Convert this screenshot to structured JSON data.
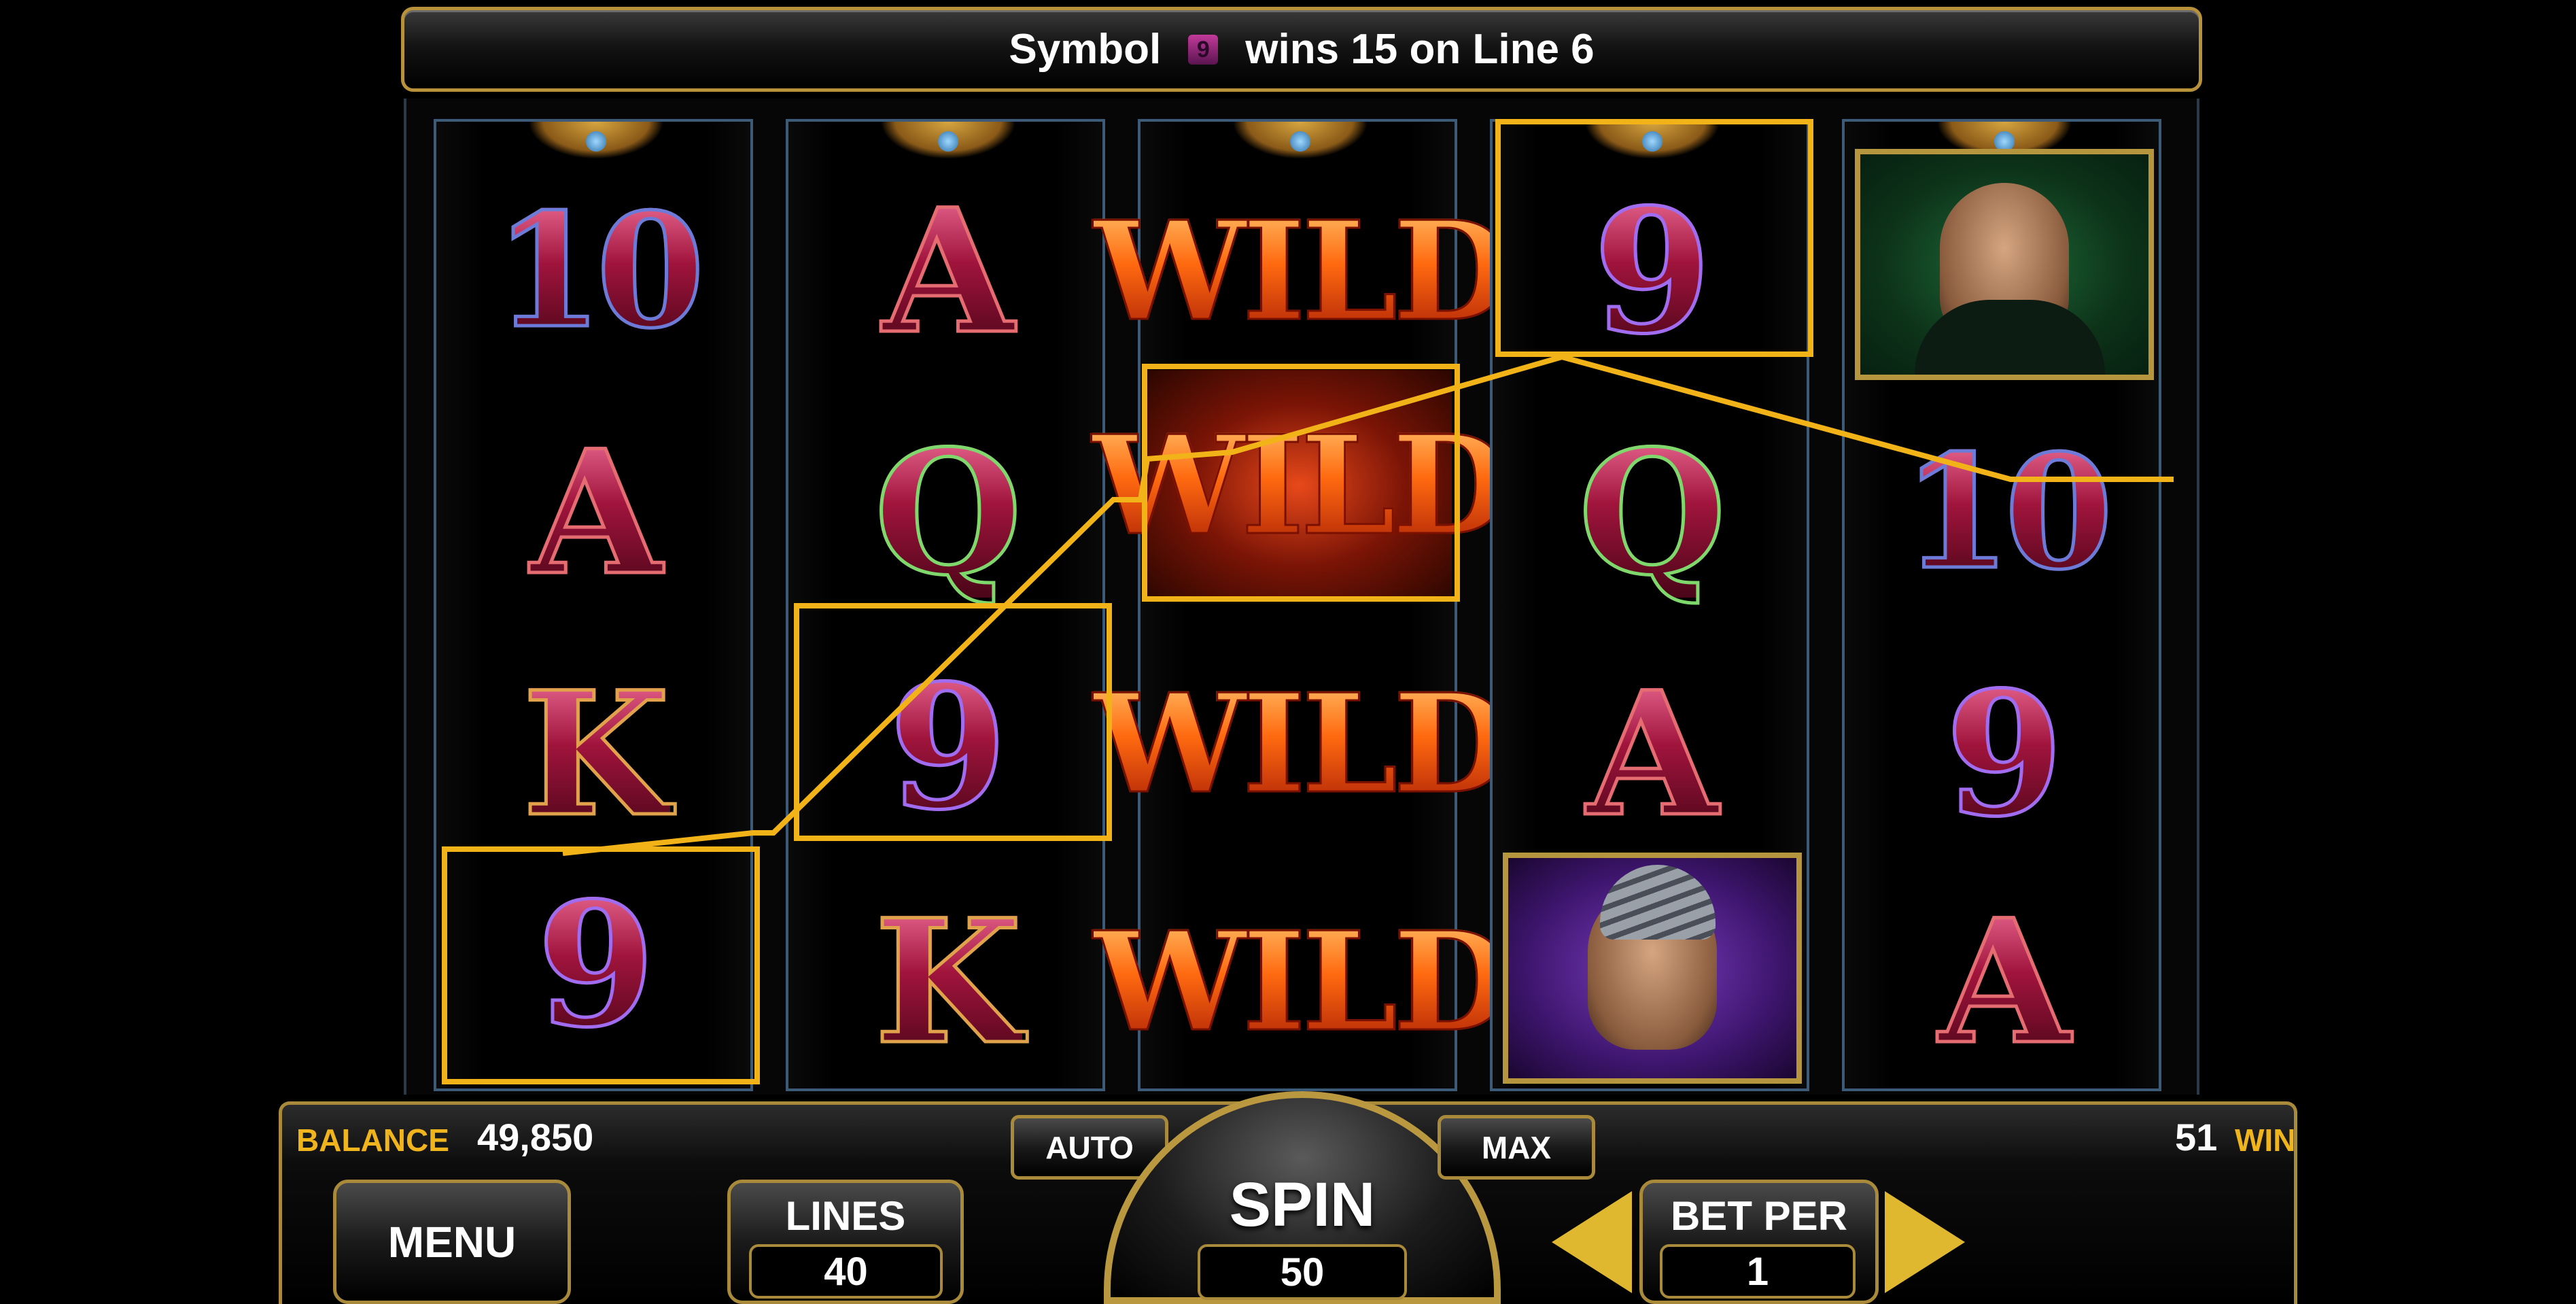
{
  "banner": {
    "prefix": "Symbol",
    "icon": "9",
    "suffix": "wins 15 on Line 6"
  },
  "reels": [
    [
      "10",
      "A",
      "K",
      "9"
    ],
    [
      "A",
      "Q",
      "9",
      "K"
    ],
    [
      "WILD",
      "WILD",
      "WILD",
      "WILD"
    ],
    [
      "9",
      "Q",
      "A",
      "portrait-arab"
    ],
    [
      "portrait-suit",
      "10",
      "9",
      "A"
    ]
  ],
  "win_line": {
    "line": 6,
    "highlighted_cells": [
      [
        0,
        3
      ],
      [
        1,
        2
      ],
      [
        2,
        1
      ],
      [
        3,
        0
      ]
    ]
  },
  "colors": {
    "accent": "#f2b318",
    "frame_gold": "#a88a3a",
    "wild": "#ff6a10"
  },
  "console": {
    "balance_label": "BALANCE",
    "balance": "49,850",
    "win_label": "WIN",
    "win": "51",
    "menu_label": "MENU",
    "lines_label": "LINES",
    "lines_value": "40",
    "auto_label": "AUTO",
    "max_label": "MAX",
    "spin_label": "SPIN",
    "spin_value": "50",
    "bet_per_label": "BET PER",
    "bet_per_value": "1"
  }
}
